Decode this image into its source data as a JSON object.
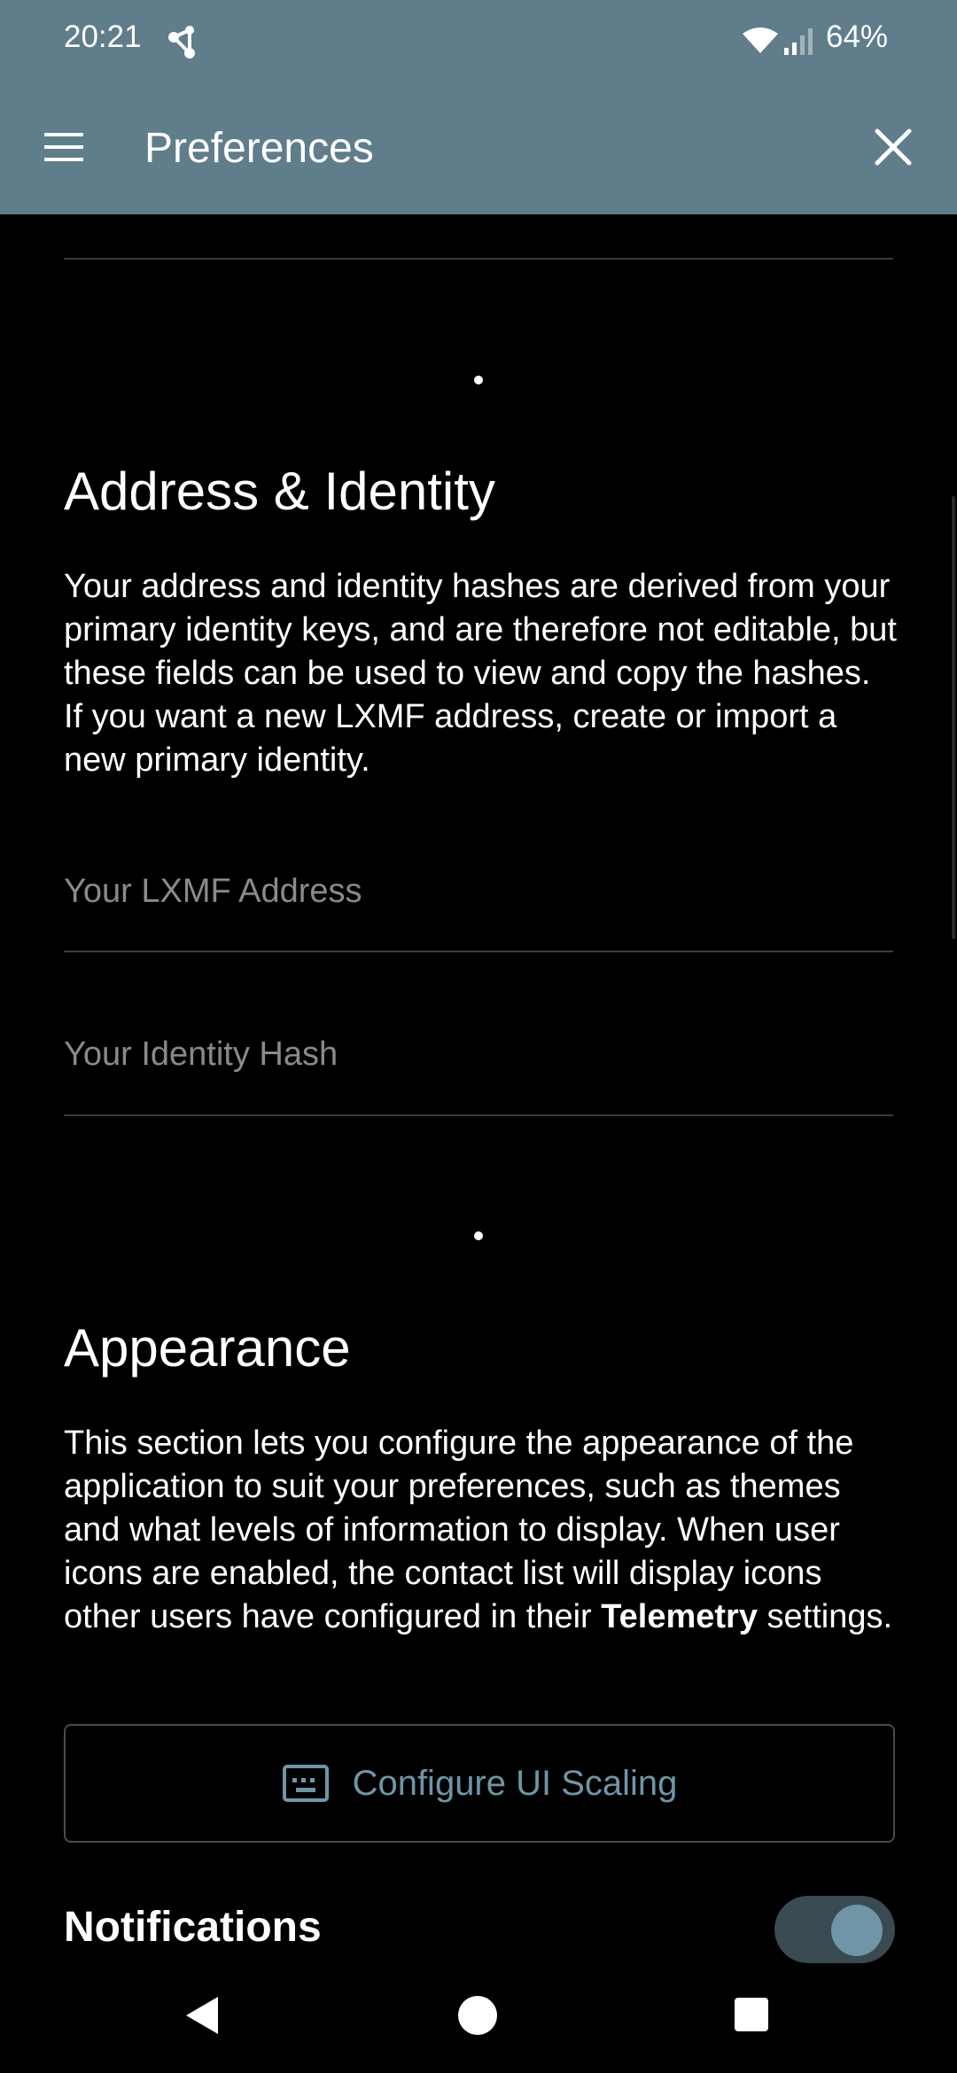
{
  "status": {
    "time": "20:21",
    "battery": "64%"
  },
  "appbar": {
    "title": "Preferences"
  },
  "sections": {
    "address_identity": {
      "heading": "Address & Identity",
      "description": "Your address and identity hashes are derived from your primary identity keys, and are therefore not editable, but these fields can be used to view and copy the hashes. If you want a new LXMF address, create or import a new primary identity.",
      "lxmf_placeholder": "Your LXMF Address",
      "identity_placeholder": "Your Identity Hash"
    },
    "appearance": {
      "heading": "Appearance",
      "description_before": "This section lets you configure the appearance of the application to suit your preferences, such as themes and what levels of information to display. When user icons are enabled, the contact list will display icons other users have configured in their ",
      "description_bold": "Telemetry",
      "description_after": " settings.",
      "scaling_button": "Configure UI Scaling"
    },
    "notifications": {
      "label": "Notifications",
      "enabled": true
    }
  },
  "icons": {
    "menu": "menu-icon",
    "close": "close-icon",
    "share": "share-icon",
    "wifi": "wifi-icon",
    "signal": "signal-icon",
    "scaling": "keyboard-icon",
    "nav_back": "back-icon",
    "nav_home": "home-icon",
    "nav_recents": "recents-icon"
  },
  "colors": {
    "appbar": "#607d8b",
    "accent": "#6f95a6",
    "background": "#000000"
  }
}
